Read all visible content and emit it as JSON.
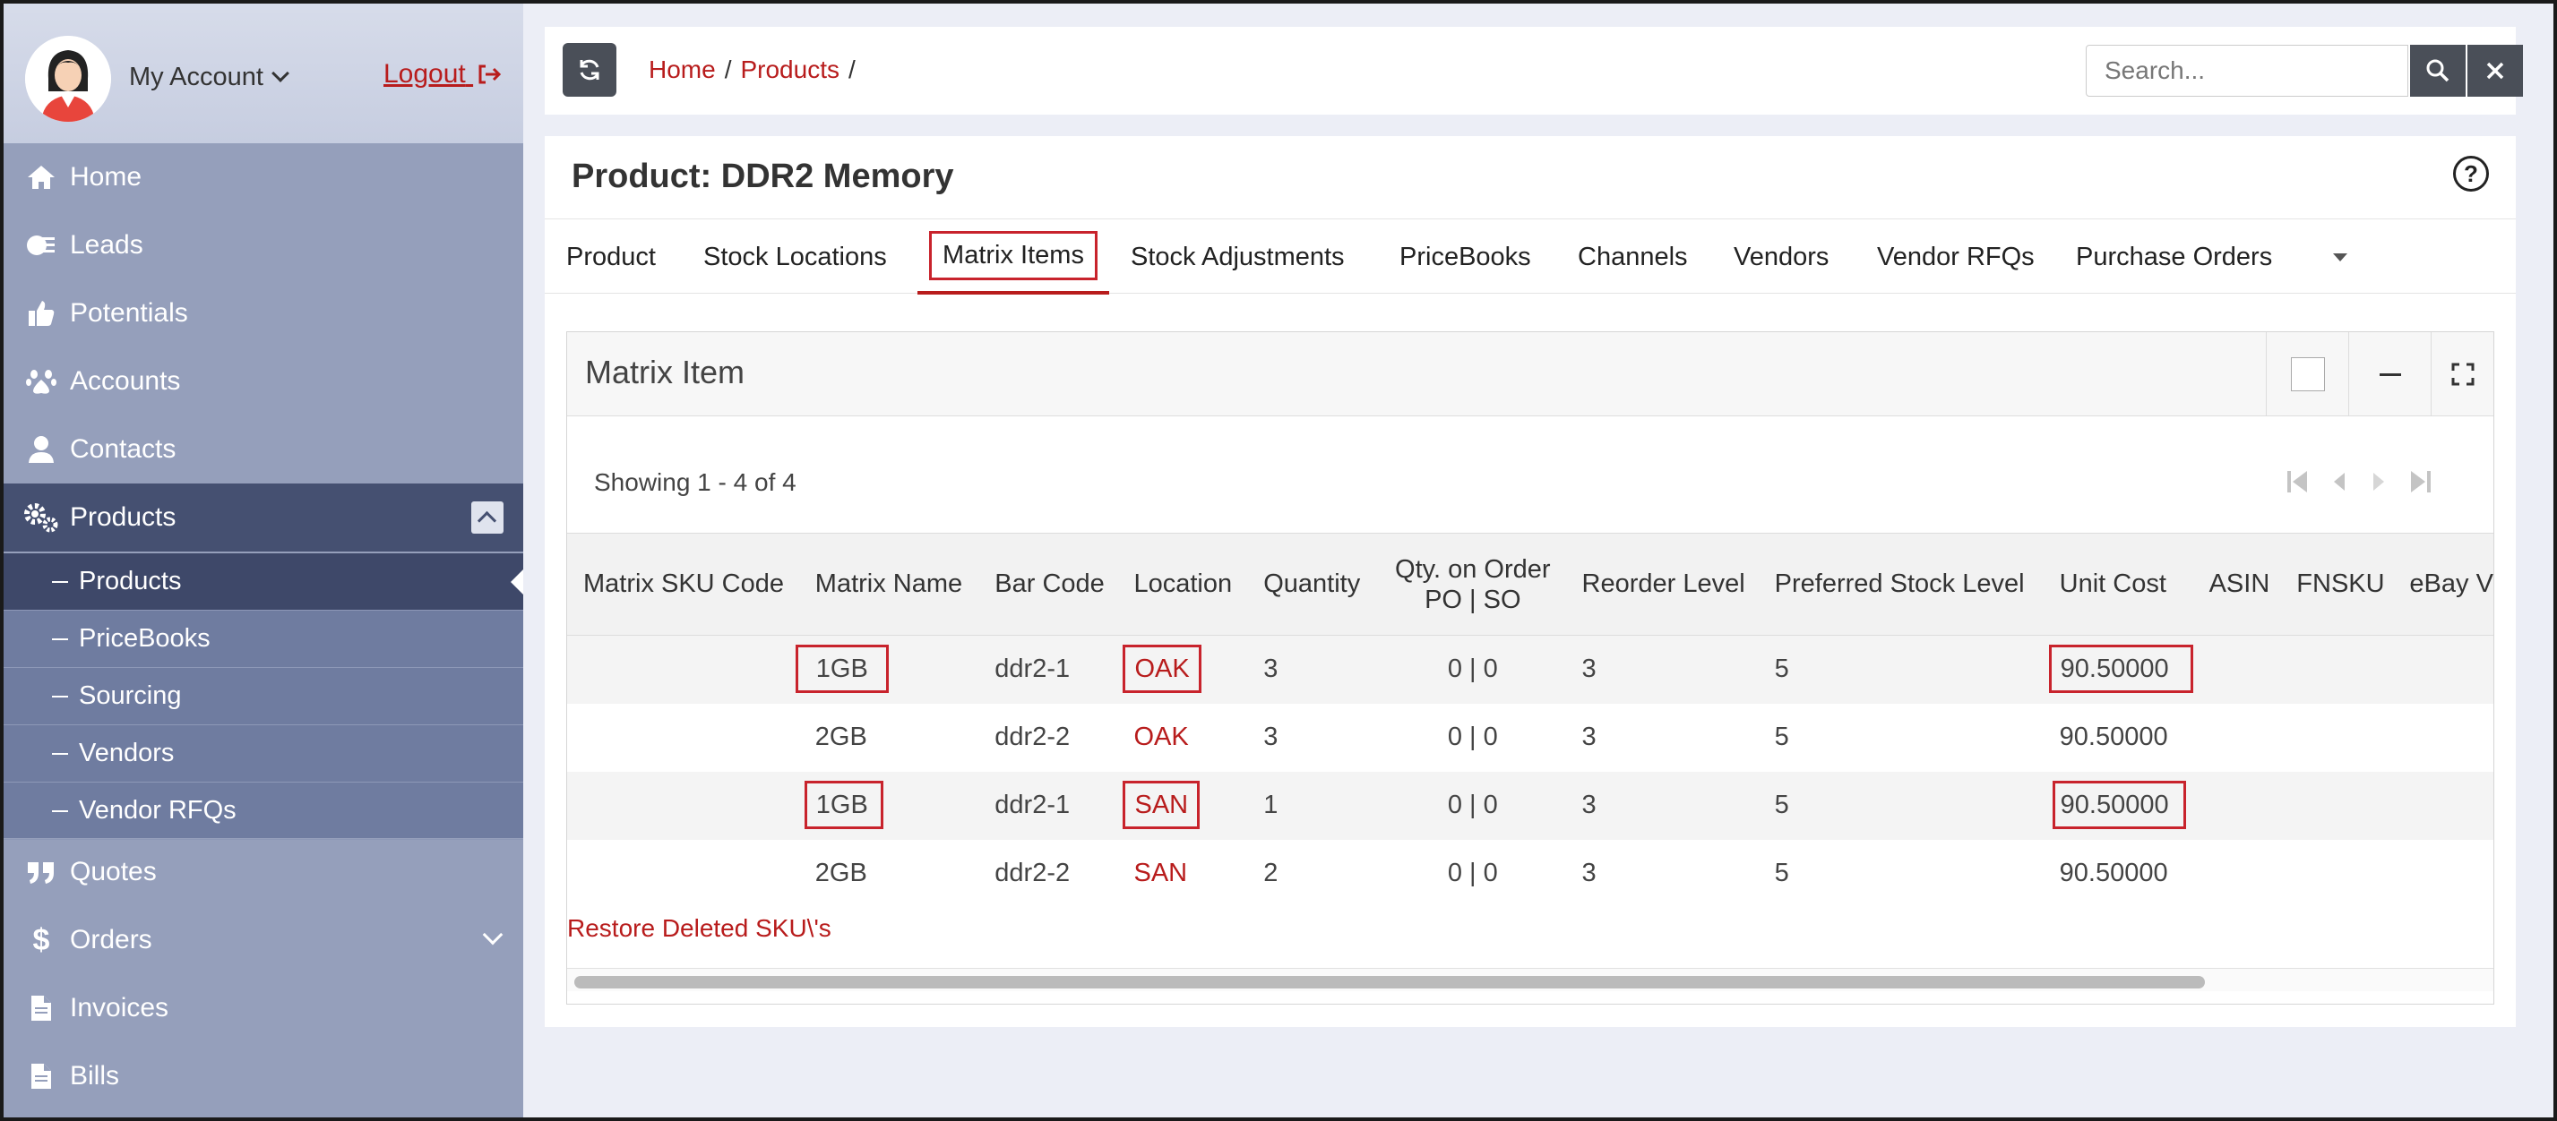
{
  "account": {
    "label": "My Account",
    "logout": "Logout"
  },
  "sidebar": {
    "items": [
      {
        "label": "Home",
        "icon": "home-icon"
      },
      {
        "label": "Leads",
        "icon": "leads-icon"
      },
      {
        "label": "Potentials",
        "icon": "thumbs-up-icon"
      },
      {
        "label": "Accounts",
        "icon": "paw-icon"
      },
      {
        "label": "Contacts",
        "icon": "user-icon"
      },
      {
        "label": "Products",
        "icon": "gears-icon"
      },
      {
        "label": "Quotes",
        "icon": "quote-icon"
      },
      {
        "label": "Orders",
        "icon": "dollar-icon"
      },
      {
        "label": "Invoices",
        "icon": "file-icon"
      },
      {
        "label": "Bills",
        "icon": "file-icon"
      }
    ],
    "sub_items": [
      "Products",
      "PriceBooks",
      "Sourcing",
      "Vendors",
      "Vendor RFQs"
    ]
  },
  "breadcrumb": {
    "home": "Home",
    "products": "Products",
    "sep": "/"
  },
  "search": {
    "placeholder": "Search..."
  },
  "page": {
    "title": "Product: DDR2 Memory"
  },
  "tabs": [
    "Product",
    "Stock Locations",
    "Matrix Items",
    "Stock Adjustments",
    "PriceBooks",
    "Channels",
    "Vendors",
    "Vendor RFQs",
    "Purchase Orders"
  ],
  "panel": {
    "title": "Matrix Item",
    "showing": "Showing 1 - 4 of 4",
    "restore": "Restore Deleted SKU\\'s"
  },
  "table": {
    "headers": [
      "Matrix SKU Code",
      "Matrix Name",
      "Bar Code",
      "Location",
      "Quantity",
      "Qty. on Order",
      "PO | SO",
      "Reorder Level",
      "Preferred Stock Level",
      "Unit Cost",
      "ASIN",
      "FNSKU",
      "eBay V"
    ],
    "rows": [
      {
        "sku": "",
        "name": "1GB",
        "bar": "ddr2-1",
        "loc": "OAK",
        "qty": "3",
        "onorder": "0 | 0",
        "reorder": "3",
        "pref": "5",
        "cost": "90.50000"
      },
      {
        "sku": "",
        "name": "2GB",
        "bar": "ddr2-2",
        "loc": "OAK",
        "qty": "3",
        "onorder": "0 | 0",
        "reorder": "3",
        "pref": "5",
        "cost": "90.50000"
      },
      {
        "sku": "",
        "name": "1GB",
        "bar": "ddr2-1",
        "loc": "SAN",
        "qty": "1",
        "onorder": "0 | 0",
        "reorder": "3",
        "pref": "5",
        "cost": "90.50000"
      },
      {
        "sku": "",
        "name": "2GB",
        "bar": "ddr2-2",
        "loc": "SAN",
        "qty": "2",
        "onorder": "0 | 0",
        "reorder": "3",
        "pref": "5",
        "cost": "90.50000"
      }
    ]
  },
  "colors": {
    "accent": "#b81c1c",
    "sidebar": "#959fbb",
    "sidebar_active": "#455071",
    "highlight": "#c8232c"
  }
}
